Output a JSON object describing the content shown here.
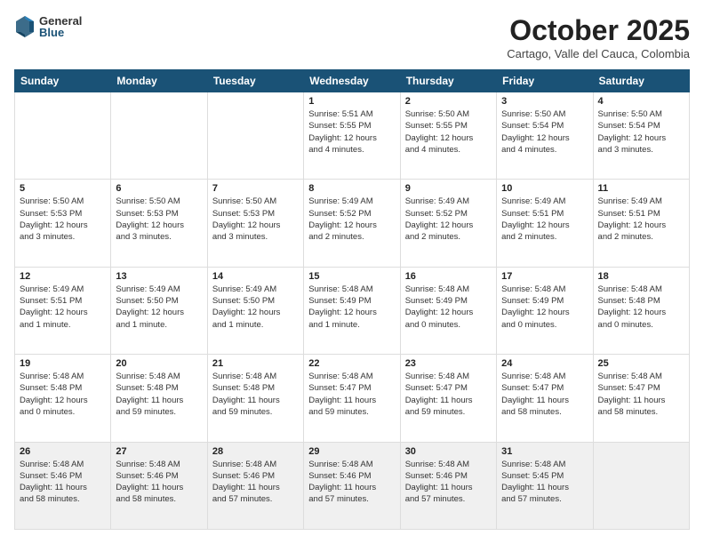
{
  "header": {
    "logo_general": "General",
    "logo_blue": "Blue",
    "month": "October 2025",
    "location": "Cartago, Valle del Cauca, Colombia"
  },
  "days_of_week": [
    "Sunday",
    "Monday",
    "Tuesday",
    "Wednesday",
    "Thursday",
    "Friday",
    "Saturday"
  ],
  "weeks": [
    [
      {
        "day": "",
        "info": ""
      },
      {
        "day": "",
        "info": ""
      },
      {
        "day": "",
        "info": ""
      },
      {
        "day": "1",
        "info": "Sunrise: 5:51 AM\nSunset: 5:55 PM\nDaylight: 12 hours\nand 4 minutes."
      },
      {
        "day": "2",
        "info": "Sunrise: 5:50 AM\nSunset: 5:55 PM\nDaylight: 12 hours\nand 4 minutes."
      },
      {
        "day": "3",
        "info": "Sunrise: 5:50 AM\nSunset: 5:54 PM\nDaylight: 12 hours\nand 4 minutes."
      },
      {
        "day": "4",
        "info": "Sunrise: 5:50 AM\nSunset: 5:54 PM\nDaylight: 12 hours\nand 3 minutes."
      }
    ],
    [
      {
        "day": "5",
        "info": "Sunrise: 5:50 AM\nSunset: 5:53 PM\nDaylight: 12 hours\nand 3 minutes."
      },
      {
        "day": "6",
        "info": "Sunrise: 5:50 AM\nSunset: 5:53 PM\nDaylight: 12 hours\nand 3 minutes."
      },
      {
        "day": "7",
        "info": "Sunrise: 5:50 AM\nSunset: 5:53 PM\nDaylight: 12 hours\nand 3 minutes."
      },
      {
        "day": "8",
        "info": "Sunrise: 5:49 AM\nSunset: 5:52 PM\nDaylight: 12 hours\nand 2 minutes."
      },
      {
        "day": "9",
        "info": "Sunrise: 5:49 AM\nSunset: 5:52 PM\nDaylight: 12 hours\nand 2 minutes."
      },
      {
        "day": "10",
        "info": "Sunrise: 5:49 AM\nSunset: 5:51 PM\nDaylight: 12 hours\nand 2 minutes."
      },
      {
        "day": "11",
        "info": "Sunrise: 5:49 AM\nSunset: 5:51 PM\nDaylight: 12 hours\nand 2 minutes."
      }
    ],
    [
      {
        "day": "12",
        "info": "Sunrise: 5:49 AM\nSunset: 5:51 PM\nDaylight: 12 hours\nand 1 minute."
      },
      {
        "day": "13",
        "info": "Sunrise: 5:49 AM\nSunset: 5:50 PM\nDaylight: 12 hours\nand 1 minute."
      },
      {
        "day": "14",
        "info": "Sunrise: 5:49 AM\nSunset: 5:50 PM\nDaylight: 12 hours\nand 1 minute."
      },
      {
        "day": "15",
        "info": "Sunrise: 5:48 AM\nSunset: 5:49 PM\nDaylight: 12 hours\nand 1 minute."
      },
      {
        "day": "16",
        "info": "Sunrise: 5:48 AM\nSunset: 5:49 PM\nDaylight: 12 hours\nand 0 minutes."
      },
      {
        "day": "17",
        "info": "Sunrise: 5:48 AM\nSunset: 5:49 PM\nDaylight: 12 hours\nand 0 minutes."
      },
      {
        "day": "18",
        "info": "Sunrise: 5:48 AM\nSunset: 5:48 PM\nDaylight: 12 hours\nand 0 minutes."
      }
    ],
    [
      {
        "day": "19",
        "info": "Sunrise: 5:48 AM\nSunset: 5:48 PM\nDaylight: 12 hours\nand 0 minutes."
      },
      {
        "day": "20",
        "info": "Sunrise: 5:48 AM\nSunset: 5:48 PM\nDaylight: 11 hours\nand 59 minutes."
      },
      {
        "day": "21",
        "info": "Sunrise: 5:48 AM\nSunset: 5:48 PM\nDaylight: 11 hours\nand 59 minutes."
      },
      {
        "day": "22",
        "info": "Sunrise: 5:48 AM\nSunset: 5:47 PM\nDaylight: 11 hours\nand 59 minutes."
      },
      {
        "day": "23",
        "info": "Sunrise: 5:48 AM\nSunset: 5:47 PM\nDaylight: 11 hours\nand 59 minutes."
      },
      {
        "day": "24",
        "info": "Sunrise: 5:48 AM\nSunset: 5:47 PM\nDaylight: 11 hours\nand 58 minutes."
      },
      {
        "day": "25",
        "info": "Sunrise: 5:48 AM\nSunset: 5:47 PM\nDaylight: 11 hours\nand 58 minutes."
      }
    ],
    [
      {
        "day": "26",
        "info": "Sunrise: 5:48 AM\nSunset: 5:46 PM\nDaylight: 11 hours\nand 58 minutes."
      },
      {
        "day": "27",
        "info": "Sunrise: 5:48 AM\nSunset: 5:46 PM\nDaylight: 11 hours\nand 58 minutes."
      },
      {
        "day": "28",
        "info": "Sunrise: 5:48 AM\nSunset: 5:46 PM\nDaylight: 11 hours\nand 57 minutes."
      },
      {
        "day": "29",
        "info": "Sunrise: 5:48 AM\nSunset: 5:46 PM\nDaylight: 11 hours\nand 57 minutes."
      },
      {
        "day": "30",
        "info": "Sunrise: 5:48 AM\nSunset: 5:46 PM\nDaylight: 11 hours\nand 57 minutes."
      },
      {
        "day": "31",
        "info": "Sunrise: 5:48 AM\nSunset: 5:45 PM\nDaylight: 11 hours\nand 57 minutes."
      },
      {
        "day": "",
        "info": ""
      }
    ]
  ]
}
